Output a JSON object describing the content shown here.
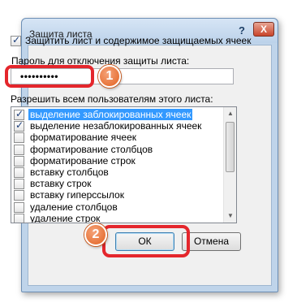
{
  "dialog": {
    "title": "Защита листа",
    "help_label": "?",
    "close_label": "X"
  },
  "protect_checkbox": {
    "label": "Защитить лист и содержимое защищаемых ячеек",
    "checked": true
  },
  "password": {
    "label": "Пароль для отключения защиты листа:",
    "value": "••••••••••"
  },
  "permissions": {
    "label": "Разрешить всем пользователям этого листа:",
    "items": [
      {
        "label": "выделение заблокированных ячеек",
        "checked": true,
        "selected": true
      },
      {
        "label": "выделение незаблокированных ячеек",
        "checked": true,
        "selected": false
      },
      {
        "label": "форматирование ячеек",
        "checked": false,
        "selected": false
      },
      {
        "label": "форматирование столбцов",
        "checked": false,
        "selected": false
      },
      {
        "label": "форматирование строк",
        "checked": false,
        "selected": false
      },
      {
        "label": "вставку столбцов",
        "checked": false,
        "selected": false
      },
      {
        "label": "вставку строк",
        "checked": false,
        "selected": false
      },
      {
        "label": "вставку гиперссылок",
        "checked": false,
        "selected": false
      },
      {
        "label": "удаление столбцов",
        "checked": false,
        "selected": false
      },
      {
        "label": "удаление строк",
        "checked": false,
        "selected": false
      }
    ]
  },
  "buttons": {
    "ok": "ОК",
    "cancel": "Отмена"
  },
  "badges": {
    "step1": "1",
    "step2": "2"
  },
  "colors": {
    "highlight": "#e4262c",
    "badge": "#e2611f",
    "selection": "#3399ff"
  }
}
